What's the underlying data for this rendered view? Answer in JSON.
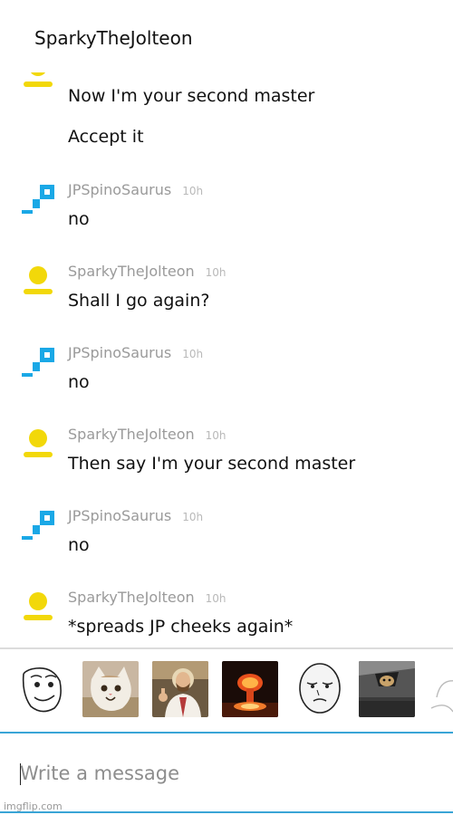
{
  "header": {
    "name": "SparkyTheJolteon"
  },
  "messages": [
    {
      "text": "Now I'm your second master"
    },
    {
      "text": "Accept it"
    },
    {
      "author": "JPSpinoSaurus",
      "time": "10h",
      "text": "no"
    },
    {
      "author": "SparkyTheJolteon",
      "time": "10h",
      "text": "Shall I go again?"
    },
    {
      "author": "JPSpinoSaurus",
      "time": "10h",
      "text": "no"
    },
    {
      "author": "SparkyTheJolteon",
      "time": "10h",
      "text": "Then say I'm your second master"
    },
    {
      "author": "JPSpinoSaurus",
      "time": "10h",
      "text": "no"
    },
    {
      "author": "SparkyTheJolteon",
      "time": "10h",
      "text": "*spreads JP cheeks again*"
    }
  ],
  "avatars": {
    "sparky": {
      "icon": "yellow-person-icon",
      "color": "#f2d80a"
    },
    "jp": {
      "icon": "blue-p-logo-icon",
      "color": "#1aa8e6"
    }
  },
  "stickers": [
    {
      "icon": "smiling-rage-face-icon"
    },
    {
      "icon": "smiling-cat-icon"
    },
    {
      "icon": "buddy-christ-icon"
    },
    {
      "icon": "nuclear-explosion-icon"
    },
    {
      "icon": "okay-face-icon"
    },
    {
      "icon": "ceiling-cat-icon"
    },
    {
      "icon": "partial-face-icon"
    }
  ],
  "composer": {
    "placeholder": "Write a message"
  },
  "watermark": "imgflip.com",
  "colors": {
    "accent": "#3aa5d6",
    "meta": "#9a9a9a"
  }
}
